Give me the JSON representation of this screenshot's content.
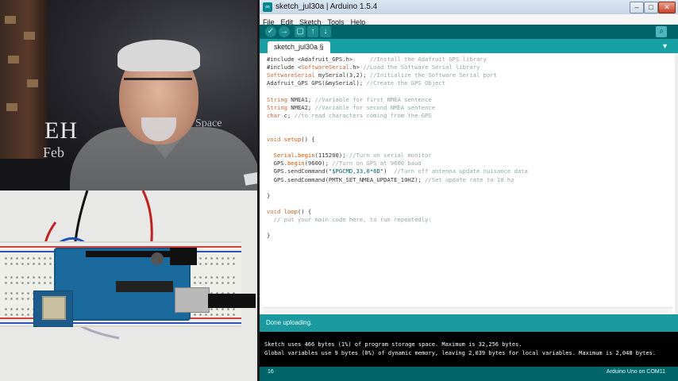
{
  "video": {
    "poster_text": "EH",
    "poster_sub": "Feb",
    "poster_space": "Space"
  },
  "window": {
    "title": "sketch_jul30a | Arduino 1.5.4",
    "minimize": "–",
    "maximize": "□",
    "close": "✕"
  },
  "menu": [
    "File",
    "Edit",
    "Sketch",
    "Tools",
    "Help"
  ],
  "toolbar": {
    "verify_icon": "✓",
    "upload_icon": "→",
    "new_icon": "▢",
    "open_icon": "↑",
    "save_icon": "↓",
    "serial_icon": "⌕"
  },
  "tab": {
    "name": "sketch_jul30a §",
    "menu_icon": "▼"
  },
  "code": [
    [
      [
        "#include <Adafruit_GPS.h>     ",
        ""
      ],
      [
        "//Install the Adafruit GPS library",
        "cm"
      ]
    ],
    [
      [
        "#include <",
        ""
      ],
      [
        "SoftwareSerial",
        "ty"
      ],
      [
        ".h> ",
        ""
      ],
      [
        "//Load the Software Serial library",
        "cm"
      ]
    ],
    [
      [
        "SoftwareSerial",
        "ty"
      ],
      [
        " mySerial(3,2); ",
        ""
      ],
      [
        "//Initialize the Software Serial port",
        "cm"
      ]
    ],
    [
      [
        "Adafruit_GPS GPS(&mySerial); ",
        ""
      ],
      [
        "//Create the GPS Object",
        "cm"
      ]
    ],
    [],
    [
      [
        "String",
        "ty"
      ],
      [
        " NMEA1; ",
        ""
      ],
      [
        "//Variable for first NMEA sentence",
        "cm"
      ]
    ],
    [
      [
        "String",
        "ty"
      ],
      [
        " NMEA2; ",
        ""
      ],
      [
        "//Variable for second NMEA sentence",
        "cm"
      ]
    ],
    [
      [
        "char",
        "kw"
      ],
      [
        " c; ",
        ""
      ],
      [
        "//to read characters coming from the GPS",
        "cm"
      ]
    ],
    [],
    [],
    [
      [
        "void",
        "kw"
      ],
      [
        " ",
        ""
      ],
      [
        "setup",
        "fn"
      ],
      [
        "() {",
        ""
      ]
    ],
    [],
    [
      [
        "  ",
        ""
      ],
      [
        "Serial",
        "fn"
      ],
      [
        ".",
        ""
      ],
      [
        "begin",
        "fn"
      ],
      [
        "(115200); ",
        ""
      ],
      [
        "//Turn on serial monitor",
        "cm"
      ]
    ],
    [
      [
        "  GPS.",
        ""
      ],
      [
        "begin",
        "fn"
      ],
      [
        "(9600); ",
        ""
      ],
      [
        "//Turn on GPS at 9600 baud",
        "cm"
      ]
    ],
    [
      [
        "  GPS.sendCommand(",
        ""
      ],
      [
        "\"$PGCMD,33,0*6D\"",
        "str"
      ],
      [
        ")  ",
        ""
      ],
      [
        "//Turn off antenna update nuisance data",
        "cm"
      ]
    ],
    [
      [
        "  GPS.sendCommand(PMTK_SET_NMEA_UPDATE_10HZ); ",
        ""
      ],
      [
        "//Set update rate to 10 hz",
        "cm"
      ]
    ],
    [],
    [
      [
        "}",
        ""
      ]
    ],
    [],
    [
      [
        "void",
        "kw"
      ],
      [
        " ",
        ""
      ],
      [
        "loop",
        "fn"
      ],
      [
        "() {",
        ""
      ]
    ],
    [
      [
        "  ",
        ""
      ],
      [
        "// put your main code here, to run repeatedly:",
        "cm"
      ]
    ],
    [],
    [
      [
        "}",
        ""
      ]
    ]
  ],
  "status": {
    "message": "Done uploading."
  },
  "console": {
    "line1": "Sketch uses 466 bytes (1%) of program storage space. Maximum is 32,256 bytes.",
    "line2": "Global variables use 9 bytes (0%) of dynamic memory, leaving 2,039 bytes for local variables. Maximum is 2,048 bytes."
  },
  "footer": {
    "line_number": "16",
    "board": "Arduino Uno on COM11"
  },
  "colors": {
    "toolbar": "#006468",
    "tabbar": "#17a1a5",
    "status": "#1a9a9f"
  }
}
